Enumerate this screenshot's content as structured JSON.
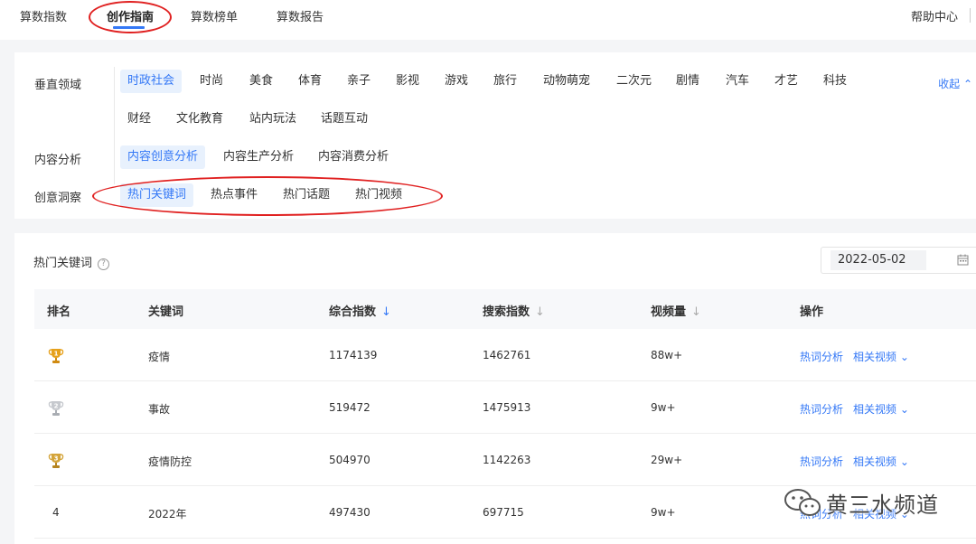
{
  "topnav": {
    "tabs": [
      "算数指数",
      "创作指南",
      "算数榜单",
      "算数报告"
    ],
    "help": "帮助中心"
  },
  "filters": {
    "vertical_label": "垂直领域",
    "vertical_items": [
      "时政社会",
      "时尚",
      "美食",
      "体育",
      "亲子",
      "影视",
      "游戏",
      "旅行",
      "动物萌宠",
      "二次元",
      "剧情",
      "汽车",
      "才艺",
      "科技",
      "财经",
      "文化教育",
      "站内玩法",
      "话题互动"
    ],
    "collapse": "收起",
    "analysis_label": "内容分析",
    "analysis_items": [
      "内容创意分析",
      "内容生产分析",
      "内容消费分析"
    ],
    "insight_label": "创意洞察",
    "insight_items": [
      "热门关键词",
      "热点事件",
      "热门话题",
      "热门视频"
    ]
  },
  "table": {
    "title": "热门关键词",
    "help_icon": "?",
    "date": "2022-05-02",
    "columns": {
      "rank": "排名",
      "keyword": "关键词",
      "composite": "综合指数",
      "search": "搜索指数",
      "videos": "视频量",
      "ops": "操作"
    },
    "sort_arrow": "↓",
    "rows": [
      {
        "rank": "1",
        "keyword": "疫情",
        "composite": "1174139",
        "search": "1462761",
        "videos": "88w+",
        "op1": "热词分析",
        "op2": "相关视频"
      },
      {
        "rank": "2",
        "keyword": "事故",
        "composite": "519472",
        "search": "1475913",
        "videos": "9w+",
        "op1": "热词分析",
        "op2": "相关视频"
      },
      {
        "rank": "3",
        "keyword": "疫情防控",
        "composite": "504970",
        "search": "1142263",
        "videos": "29w+",
        "op1": "热词分析",
        "op2": "相关视频"
      },
      {
        "rank": "4",
        "keyword": "2022年",
        "composite": "497430",
        "search": "697715",
        "videos": "9w+",
        "op1": "热词分析",
        "op2": "相关视频"
      }
    ]
  },
  "watermark": {
    "text": "黄三水频道"
  },
  "colors": {
    "accent": "#3478f6",
    "gold": "#e6a11c",
    "silver": "#b9bcc2",
    "annotation": "#e02020"
  }
}
